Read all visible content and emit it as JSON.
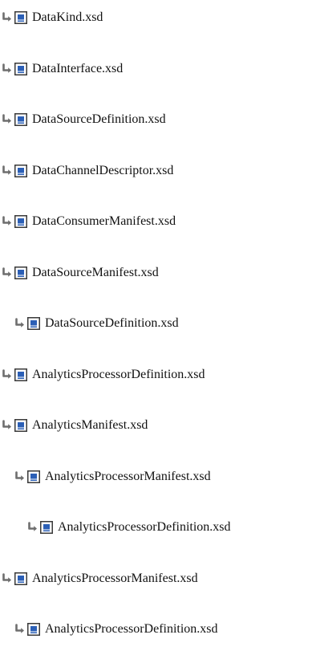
{
  "tree": {
    "items": [
      {
        "label": "DataKind.xsd",
        "level": 0
      },
      {
        "label": "DataInterface.xsd",
        "level": 0
      },
      {
        "label": "DataSourceDefinition.xsd",
        "level": 0
      },
      {
        "label": "DataChannelDescriptor.xsd",
        "level": 0
      },
      {
        "label": "DataConsumerManifest.xsd",
        "level": 0
      },
      {
        "label": "DataSourceManifest.xsd",
        "level": 0
      },
      {
        "label": "DataSourceDefinition.xsd",
        "level": 1
      },
      {
        "label": "AnalyticsProcessorDefinition.xsd",
        "level": 0
      },
      {
        "label": "AnalyticsManifest.xsd",
        "level": 0
      },
      {
        "label": "AnalyticsProcessorManifest.xsd",
        "level": 1
      },
      {
        "label": "AnalyticsProcessorDefinition.xsd",
        "level": 2
      },
      {
        "label": "AnalyticsProcessorManifest.xsd",
        "level": 0
      },
      {
        "label": "AnalyticsProcessorDefinition.xsd",
        "level": 1
      }
    ]
  },
  "icons": {
    "arrow": "return-arrow-icon",
    "file": "xsd-file-icon"
  },
  "colors": {
    "arrow": "#6e6e6e",
    "file_fill": "#2b5fb6",
    "file_border": "#3a3a3a",
    "text": "#111111"
  }
}
